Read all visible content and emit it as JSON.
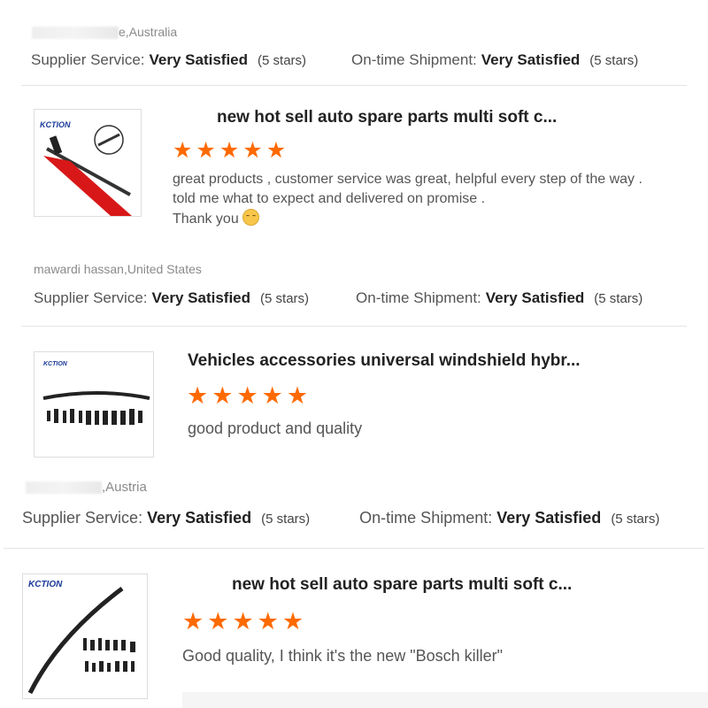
{
  "reviews": [
    {
      "reviewer_suffix": "e,Australia",
      "supplier_label": "Supplier Service:",
      "supplier_value": "Very Satisfied",
      "supplier_stars": "(5 stars)",
      "shipment_label": "On-time Shipment:",
      "shipment_value": "Very Satisfied",
      "shipment_stars": "(5 stars)"
    },
    {
      "brand": "KCTION",
      "title": "new hot sell auto spare parts multi soft c...",
      "rating": 5,
      "text_lines": [
        "great products , customer service was great, helpful every step of the way .",
        "told me what to expect and delivered on promise .",
        "Thank you"
      ],
      "reviewer": "mawardi hassan,United States",
      "supplier_label": "Supplier Service:",
      "supplier_value": "Very Satisfied",
      "supplier_stars": "(5 stars)",
      "shipment_label": "On-time Shipment:",
      "shipment_value": "Very Satisfied",
      "shipment_stars": "(5 stars)"
    },
    {
      "brand": "KCTION",
      "title": "Vehicles accessories universal windshield hybr...",
      "rating": 5,
      "text": "good product and quality",
      "reviewer_suffix": ",Austria",
      "supplier_label": "Supplier Service:",
      "supplier_value": "Very Satisfied",
      "supplier_stars": "(5 stars)",
      "shipment_label": "On-time Shipment:",
      "shipment_value": "Very Satisfied",
      "shipment_stars": "(5 stars)"
    },
    {
      "brand": "KCTION",
      "title": "new hot sell auto spare parts multi soft c...",
      "rating": 5,
      "text": "Good quality, I think it's the new \"Bosch killer\""
    }
  ],
  "colors": {
    "star": "#ff6a00",
    "brand": "#1a3a9a"
  }
}
